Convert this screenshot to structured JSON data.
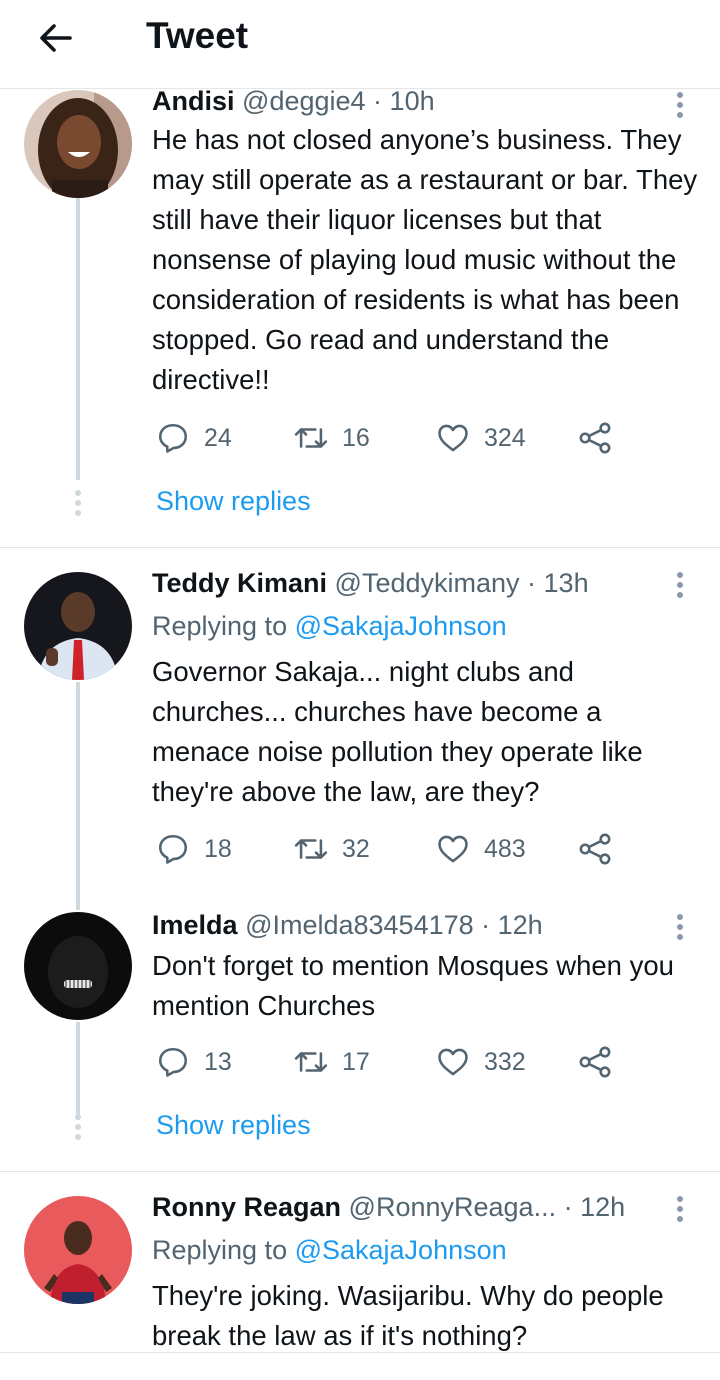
{
  "header": {
    "title": "Tweet"
  },
  "tweets": [
    {
      "name": "Andisi",
      "handle": "@deggie4",
      "sep": " · ",
      "time": "10h",
      "body": "He has not closed anyone’s business. They may still operate as a restaurant or bar. They still have their liquor licenses but that nonsense of playing loud music without the consideration of residents is what has been stopped. Go read and understand the directive!!",
      "replies": "24",
      "retweets": "16",
      "likes": "324",
      "show_replies": "Show replies"
    },
    {
      "name": "Teddy Kimani",
      "handle": "@Teddykimany",
      "sep": " · ",
      "time": "13h",
      "replying_prefix": "Replying to ",
      "replying_to": "@SakajaJohnson",
      "body": "Governor Sakaja... night clubs and churches... churches have become a menace noise pollution they operate like they're above the law, are they?",
      "replies": "18",
      "retweets": "32",
      "likes": "483"
    },
    {
      "name": "Imelda",
      "handle": "@Imelda83454178",
      "sep": " · ",
      "time": "12h",
      "body": "Don't forget to mention Mosques when you mention Churches",
      "replies": "13",
      "retweets": "17",
      "likes": "332",
      "show_replies": "Show replies"
    },
    {
      "name": "Ronny Reagan",
      "handle": "@RonnyReaga...",
      "sep": " · ",
      "time": "12h",
      "replying_prefix": "Replying to ",
      "replying_to": "@SakajaJohnson",
      "body": "They're joking. Wasijaribu. Why do people break the law as if it's nothing?"
    }
  ],
  "colors": {
    "accent": "#1d9bf0",
    "secondary_text": "#536471",
    "thread_line": "#cfd9de"
  },
  "icons": [
    "back-arrow-icon",
    "more-vertical-icon",
    "reply-icon",
    "retweet-icon",
    "like-icon",
    "share-icon"
  ]
}
